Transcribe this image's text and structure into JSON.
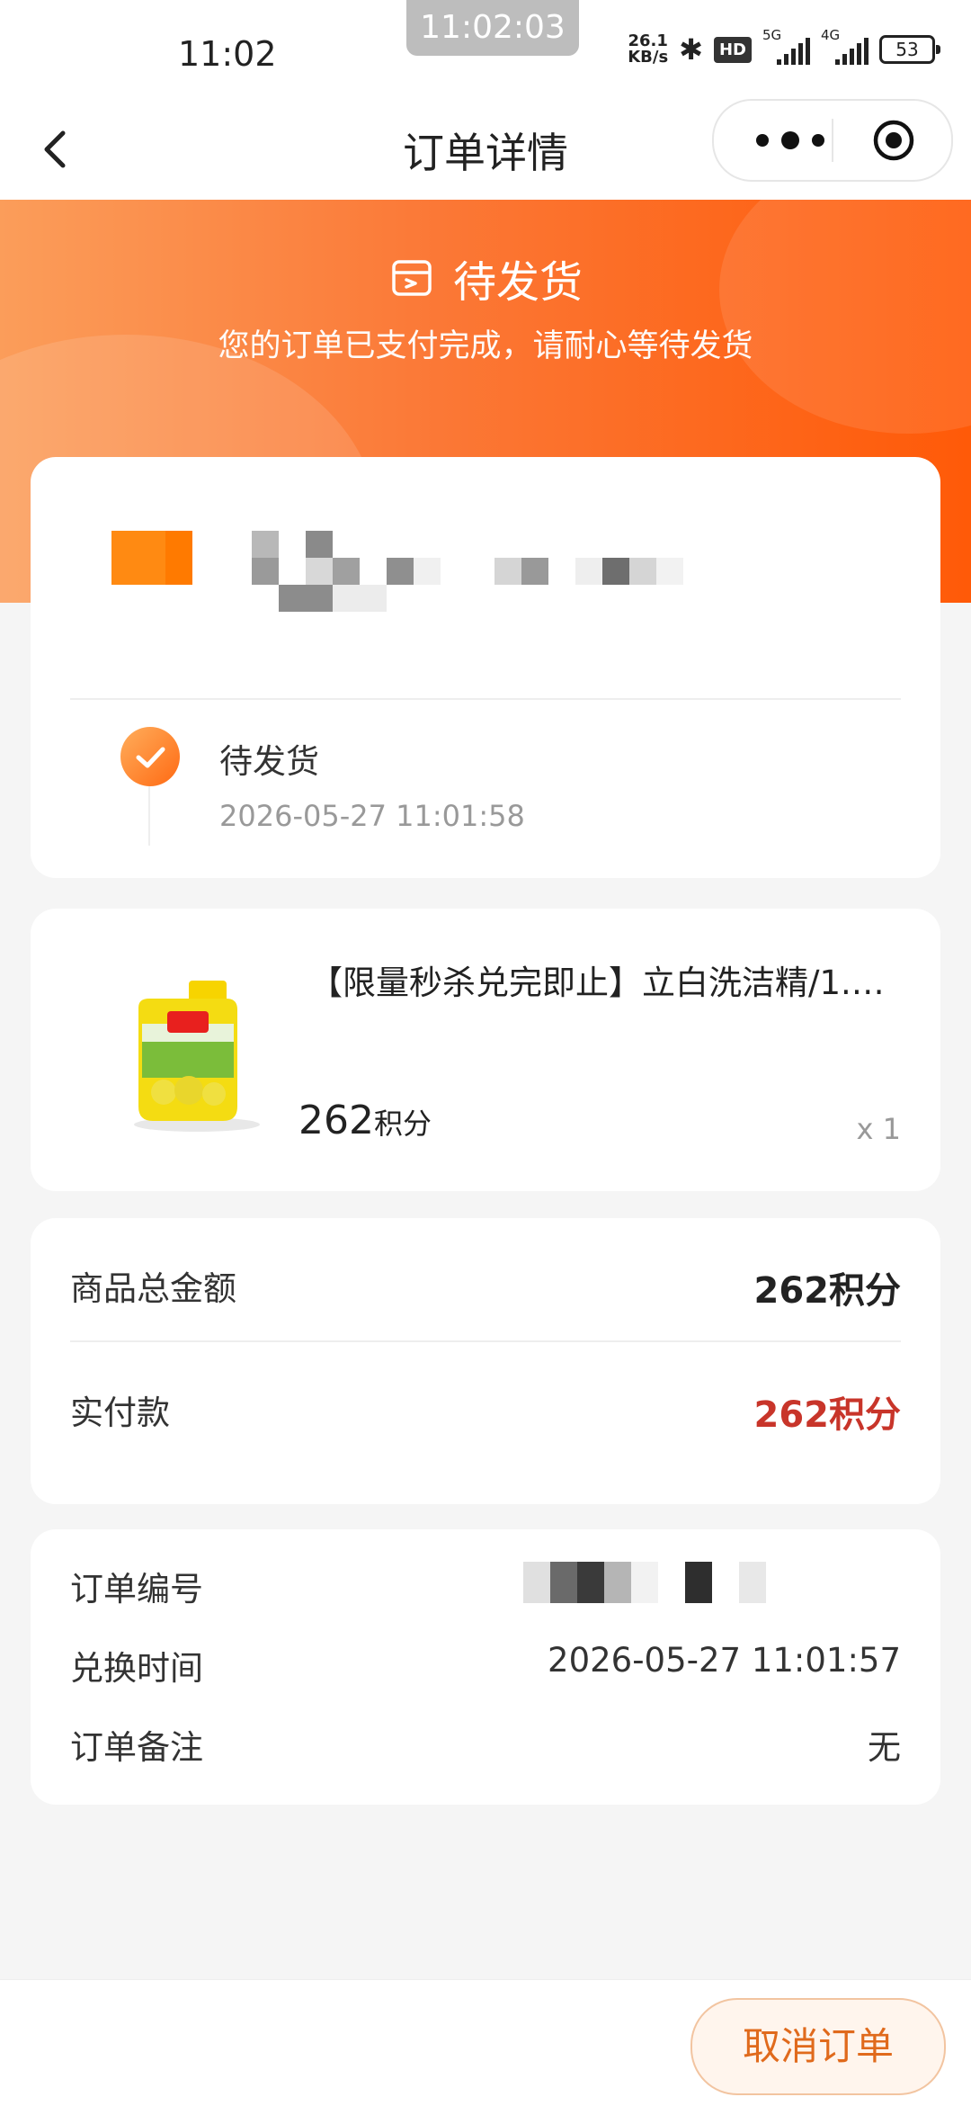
{
  "status_bar": {
    "time": "11:02",
    "clock_overlay": "11:02:03",
    "net_speed_value": "26.1",
    "net_speed_unit": "KB/s",
    "hd_label": "HD",
    "signal1_label": "5G",
    "signal2_label": "4G",
    "battery": "53",
    "icons": [
      "bluetooth-icon",
      "signal-icon",
      "battery-icon"
    ]
  },
  "nav": {
    "title": "订单详情",
    "back_icon": "chevron-left-icon",
    "more_icon": "more-dots-icon",
    "close_icon": "target-icon"
  },
  "header": {
    "status_title": "待发货",
    "status_subtitle": "您的订单已支付完成，请耐心等待发货",
    "status_icon": "order-box-icon",
    "gradient_colors": [
      "#fb9d5a",
      "#ff5a08"
    ]
  },
  "timeline": {
    "status": "待发货",
    "time": "2026-05-27 11:01:58"
  },
  "goods": {
    "name": "【限量秒杀兑完即止】立白洗洁精/1.…",
    "price": "262",
    "price_unit": "积分",
    "qty": "x 1"
  },
  "amounts": {
    "total_label": "商品总金额",
    "total_value": "262积分",
    "paid_label": "实付款",
    "paid_value": "262积分",
    "paid_color": "#c8352a"
  },
  "info": {
    "order_no_label": "订单编号",
    "exchange_time_label": "兑换时间",
    "exchange_time_value": "2026-05-27 11:01:57",
    "remark_label": "订单备注",
    "remark_value": "无"
  },
  "bottom": {
    "cancel_label": "取消订单"
  }
}
